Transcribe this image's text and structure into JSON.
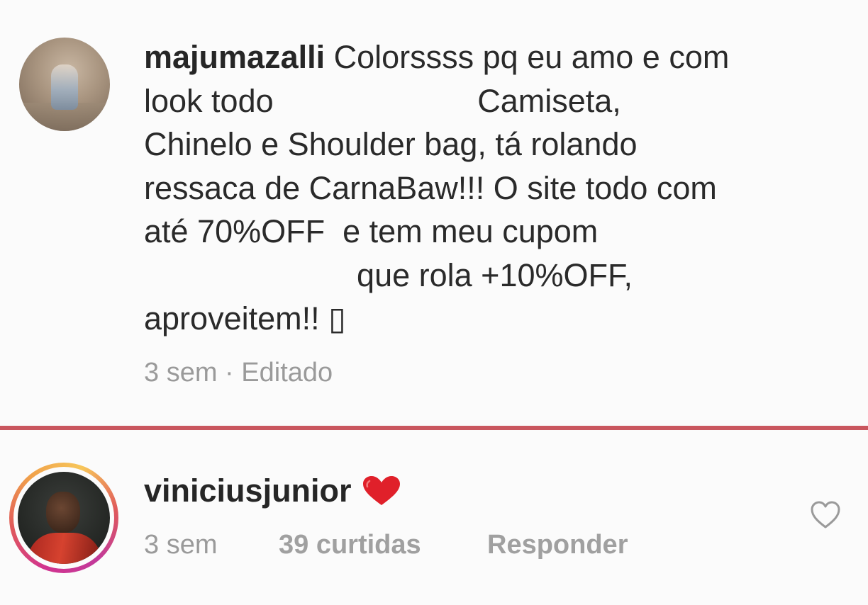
{
  "comments": [
    {
      "username": "majumazalli",
      "text_lines": [
        " Colorssss pq eu amo e com",
        "look todo                       Camiseta,",
        "Chinelo e Shoulder bag, tá rolando",
        "ressaca de CarnaBaw!!! O site todo com",
        "até 70%OFF  e tem meu cupom",
        "                        que rola +10%OFF,",
        "aproveitem!! ▯"
      ],
      "time": "3 sem",
      "separator": " · ",
      "status": "Editado",
      "avatar_icon": "user-avatar-photo"
    },
    {
      "username": "viniciusjunior",
      "emoji": "heart-emoji",
      "time": "3 sem",
      "likes": "39 curtidas",
      "reply_label": "Responder",
      "avatar_icon": "user-avatar-photo-story-ring",
      "like_icon": "heart-outline-icon"
    }
  ],
  "colors": {
    "divider": "#c9565e",
    "meta_text": "#9a9a9a",
    "heart_emoji": "#e0202a",
    "background": "#fbfbfb"
  }
}
